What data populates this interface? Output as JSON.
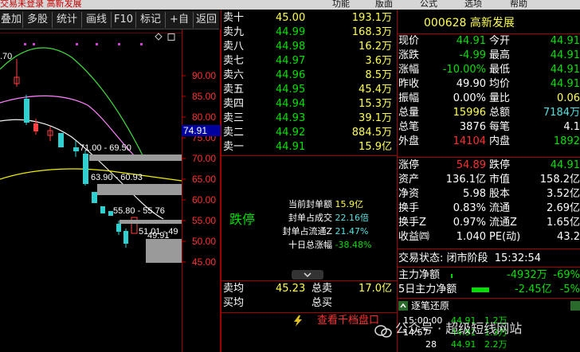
{
  "titlebar": {
    "left_text": "交易未登录  高新发展",
    "menu": [
      "功能",
      "版面",
      "公式",
      "选项",
      "帮助"
    ]
  },
  "toolbar": {
    "buttons": [
      "叠加",
      "多股",
      "统计",
      "画线",
      "F10",
      "标记",
      "+自选",
      "返回"
    ]
  },
  "chart_data": {
    "type": "candlestick",
    "price_axis": [
      "90.00",
      "85.00",
      "80.00",
      "75.00",
      "70.00",
      "65.00",
      "60.00",
      "55.00",
      "50.00",
      "45.00"
    ],
    "current_price_tag": "74.91",
    "top_left_label": ".70",
    "range_labels": [
      "71.00 - 69.50",
      "63.90 - 60.93",
      "55.80 - 55.76",
      "51.01 - 49",
      "49.91"
    ],
    "toggle_icons": [
      "diamond",
      "square"
    ]
  },
  "order_book": {
    "sells": [
      {
        "label": "卖十",
        "price": "45.00",
        "vol": "193.1万"
      },
      {
        "label": "卖九",
        "price": "44.99",
        "vol": "168.3万"
      },
      {
        "label": "卖八",
        "price": "44.98",
        "vol": "16.2万"
      },
      {
        "label": "卖七",
        "price": "44.97",
        "vol": "3.6万"
      },
      {
        "label": "卖六",
        "price": "44.96",
        "vol": "8.5万"
      },
      {
        "label": "卖五",
        "price": "44.95",
        "vol": "45.4万"
      },
      {
        "label": "卖四",
        "price": "44.94",
        "vol": "15.3万"
      },
      {
        "label": "卖三",
        "price": "44.93",
        "vol": "39.1万"
      },
      {
        "label": "卖二",
        "price": "44.92",
        "vol": "884.5万"
      },
      {
        "label": "卖一",
        "price": "44.91",
        "vol": "15.9亿"
      }
    ],
    "limit_status": "跌停",
    "seal_info": [
      {
        "label": "当前封单额",
        "value": "15.9亿"
      },
      {
        "label": "封单占成交",
        "value": "22.16倍"
      },
      {
        "label": "封单占流通Z",
        "value": "21.47%"
      },
      {
        "label": "十日总涨幅",
        "value": "-38.48%"
      }
    ],
    "avg_sell_label": "卖均",
    "avg_sell": "45.23",
    "total_sell_label": "总卖",
    "total_sell": "17.0亿",
    "avg_buy_label": "买均",
    "total_buy_label": "总买",
    "ten_level_button": "查看千档盘口"
  },
  "quote": {
    "code": "000628",
    "name": "高新发展",
    "rows1": [
      {
        "l1": "现价",
        "v1": "44.91",
        "l2": "今开",
        "v2": "44.91"
      },
      {
        "l1": "涨跌",
        "v1": "-4.99",
        "l2": "最高",
        "v2": "44.91"
      },
      {
        "l1": "涨幅",
        "v1": "-10.00%",
        "l2": "最低",
        "v2": "44.91"
      },
      {
        "l1": "昨收",
        "v1": "49.90",
        "l2": "均价",
        "v2": "44.91"
      },
      {
        "l1": "振幅",
        "v1": "0.00%",
        "l2": "量比",
        "v2": "0.06"
      },
      {
        "l1": "总量",
        "v1": "15996",
        "l2": "总额",
        "v2": "7184万"
      },
      {
        "l1": "总笔",
        "v1": "3876",
        "l2": "每笔",
        "v2": "4.1"
      },
      {
        "l1": "外盘",
        "v1": "14104",
        "l2": "内盘",
        "v2": "1892"
      }
    ],
    "rows2": [
      {
        "l1": "涨停",
        "v1": "54.89",
        "l2": "跌停",
        "v2": "44.91"
      },
      {
        "l1": "资产",
        "v1": "136.1亿",
        "l2": "市值",
        "v2": "158.2亿"
      },
      {
        "l1": "净资",
        "v1": "5.98",
        "l2": "股本",
        "v2": "3.52亿"
      },
      {
        "l1": "换手",
        "v1": "0.83%",
        "l2": "流通",
        "v2": "2.69亿"
      },
      {
        "l1": "换手Z",
        "v1": "0.97%",
        "l2": "流通Z",
        "v2": "1.65亿"
      },
      {
        "l1": "收益㈣",
        "v1": "1.040",
        "l2": "PE(动)",
        "v2": "43.2"
      }
    ],
    "trade_status_label": "交易状态:",
    "trade_status": "闭市阶段",
    "trade_time": "15:32:54",
    "main_net_label": "主力净额",
    "main_net": "-4932万",
    "main_net_pct": "-69%",
    "main5_label": "5日主力净额",
    "main5": "-2.45亿",
    "main5_pct": "-5%",
    "ticks_tab": "逐笔还原",
    "ticks": [
      {
        "time": "15:00:00",
        "price": "44.91",
        "vol": "1.2万"
      },
      {
        "time": "14:57",
        "price": "44.91",
        "vol": "1.3万"
      },
      {
        "time": "28",
        "price": "44.91",
        "vol": "2.2万"
      }
    ]
  },
  "watermark": "公众号 · 超级短线网站"
}
